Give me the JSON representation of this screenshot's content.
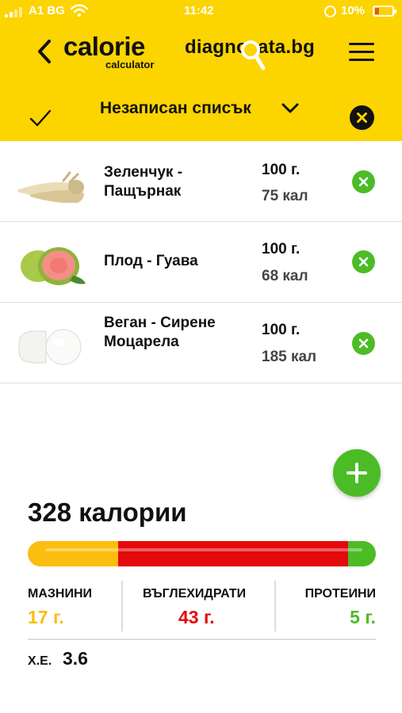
{
  "status_bar": {
    "carrier": "A1 BG",
    "time": "11:42",
    "battery": "10%"
  },
  "header": {
    "logo_main": "calorie",
    "logo_sub": "calculator",
    "brand": "diagnozata.bg",
    "list_title": "Незаписан списък"
  },
  "foods": [
    {
      "name": "Зеленчук - Пащърнак",
      "qty": "100 г.",
      "cal": "75 кал"
    },
    {
      "name": "Плод - Гуава",
      "qty": "100 г.",
      "cal": "68 кал"
    },
    {
      "name": "Веган - Сирене Моцарела",
      "qty": "100 г.",
      "cal": "185 кал"
    }
  ],
  "summary": {
    "total": "328 калории",
    "fat_label": "МАЗНИНИ",
    "fat_value": "17 г.",
    "carb_label": "ВЪГЛЕХИДРАТИ",
    "carb_value": "43 г.",
    "protein_label": "ПРОТЕИНИ",
    "protein_value": "5 г.",
    "xe_label": "Х.Е.",
    "xe_value": "3.6"
  },
  "macro_share": {
    "fat": 0.26,
    "carb": 0.66,
    "protein": 0.08
  },
  "colors": {
    "header": "#fcd400",
    "fat": "#fbbd0e",
    "carb": "#e4090d",
    "protein": "#4cbc26"
  },
  "icons": {
    "back": "chevron-left-icon",
    "menu": "hamburger-icon",
    "check": "checkmark-icon",
    "dropdown": "chevron-down-icon",
    "close": "close-icon",
    "add": "plus-icon"
  }
}
